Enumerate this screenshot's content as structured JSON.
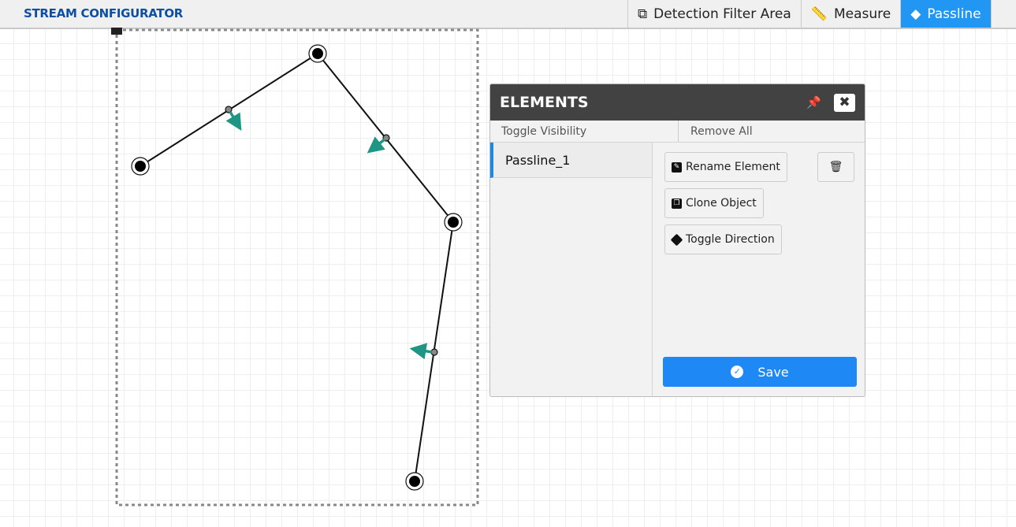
{
  "header": {
    "title": "STREAM CONFIGURATOR"
  },
  "toolbar": {
    "tools": [
      {
        "label": "Detection Filter Area",
        "icon": "layers-icon"
      },
      {
        "label": "Measure",
        "icon": "ruler-icon"
      },
      {
        "label": "Passline",
        "icon": "direction-icon",
        "active": true
      }
    ]
  },
  "panel": {
    "title": "ELEMENTS",
    "toggle_visibility": "Toggle Visibility",
    "remove_all": "Remove All",
    "elements": [
      {
        "name": "Passline_1",
        "selected": true
      }
    ],
    "actions": {
      "rename": "Rename Element",
      "clone": "Clone Object",
      "toggle_direction": "Toggle Direction",
      "save": "Save"
    }
  },
  "colors": {
    "accent": "#2196f3",
    "brand": "#0d4fa3",
    "arrow": "#1f9584",
    "panel_header": "#424242"
  }
}
